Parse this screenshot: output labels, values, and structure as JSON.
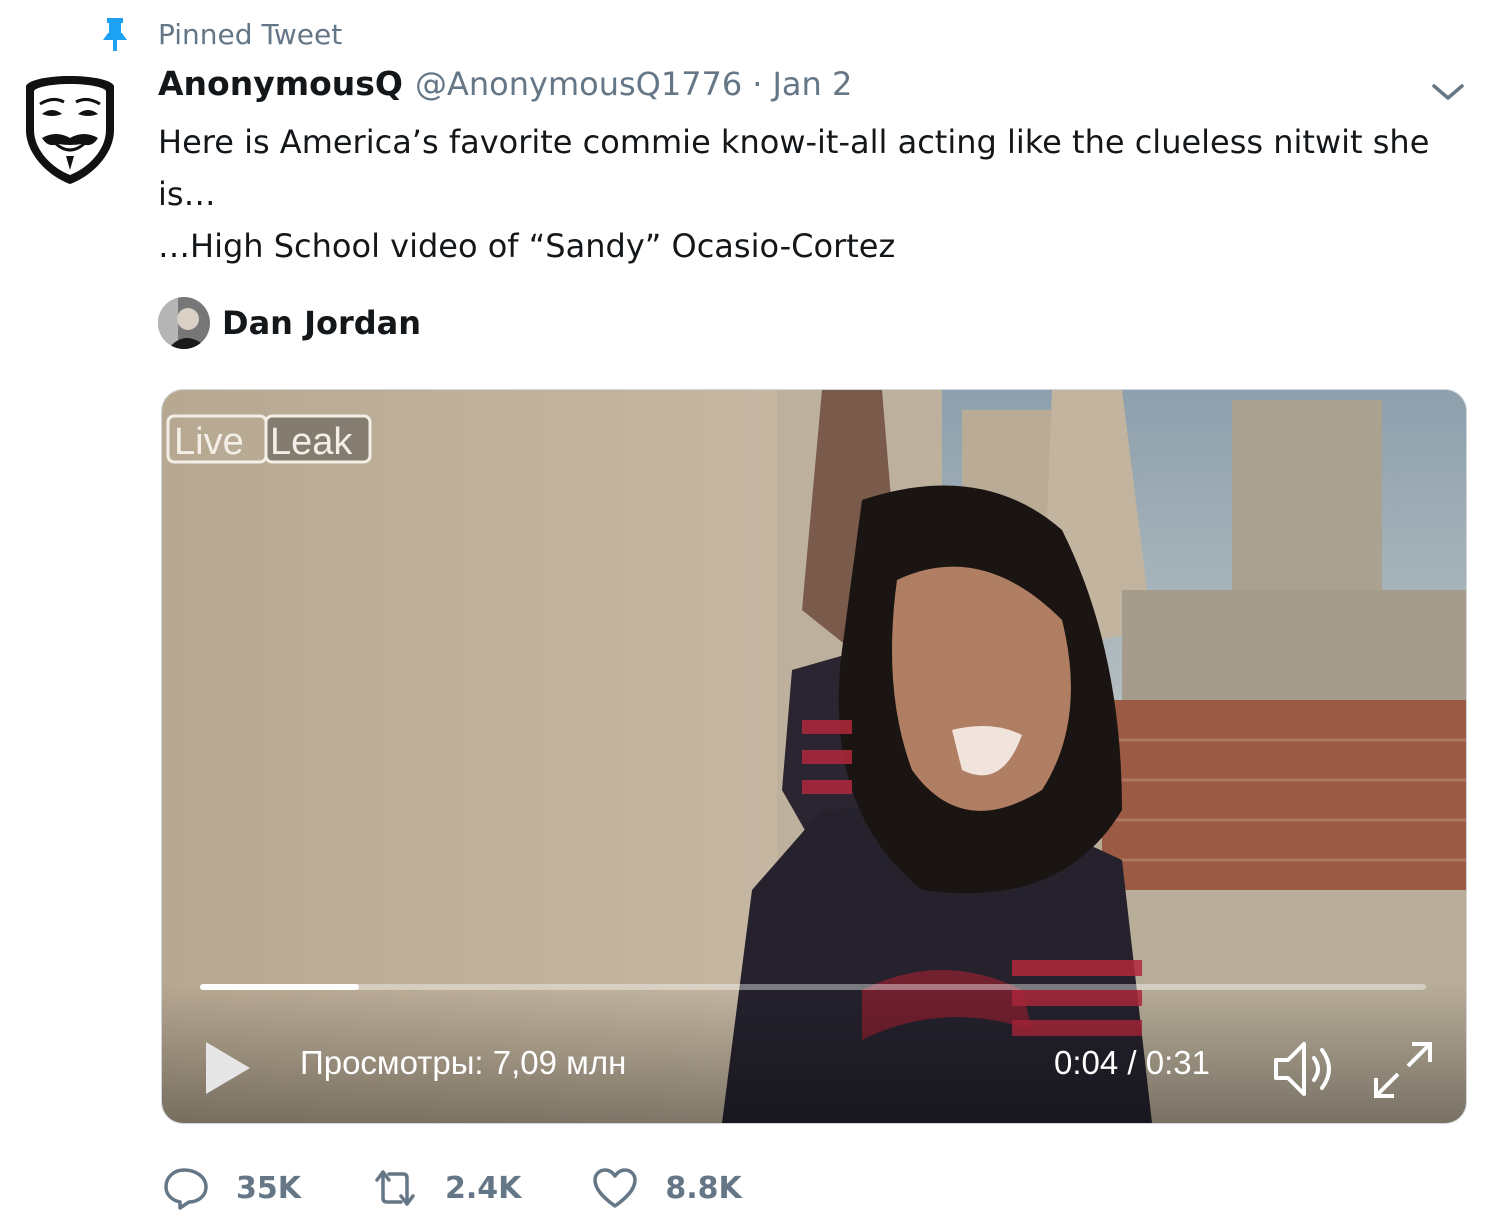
{
  "pinned": {
    "label": "Pinned Tweet",
    "icon": "pin-icon"
  },
  "tweet": {
    "author_name": "AnonymousQ",
    "handle": "@AnonymousQ1776",
    "separator": "·",
    "date": "Jan 2",
    "text_lines": [
      "Here is America’s favorite commie know-it-all acting like the clueless nitwit she is…",
      "…High School video of “Sandy” Ocasio-Cortez"
    ],
    "attribution_name": "Dan Jordan"
  },
  "video": {
    "watermark": "LiveLeak",
    "views": "Просмотры: 7,09 млн",
    "time": "0:04 / 0:31",
    "progress": 0.13,
    "icons": [
      "play-icon",
      "volume-icon",
      "fullscreen-icon"
    ]
  },
  "actions": {
    "reply_count": "35K",
    "retweet_count": "2.4K",
    "like_count": "8.8K"
  },
  "colors": {
    "pin_blue": "#1da1f2",
    "secondary_text": "#657786",
    "primary_text": "#14171a"
  }
}
